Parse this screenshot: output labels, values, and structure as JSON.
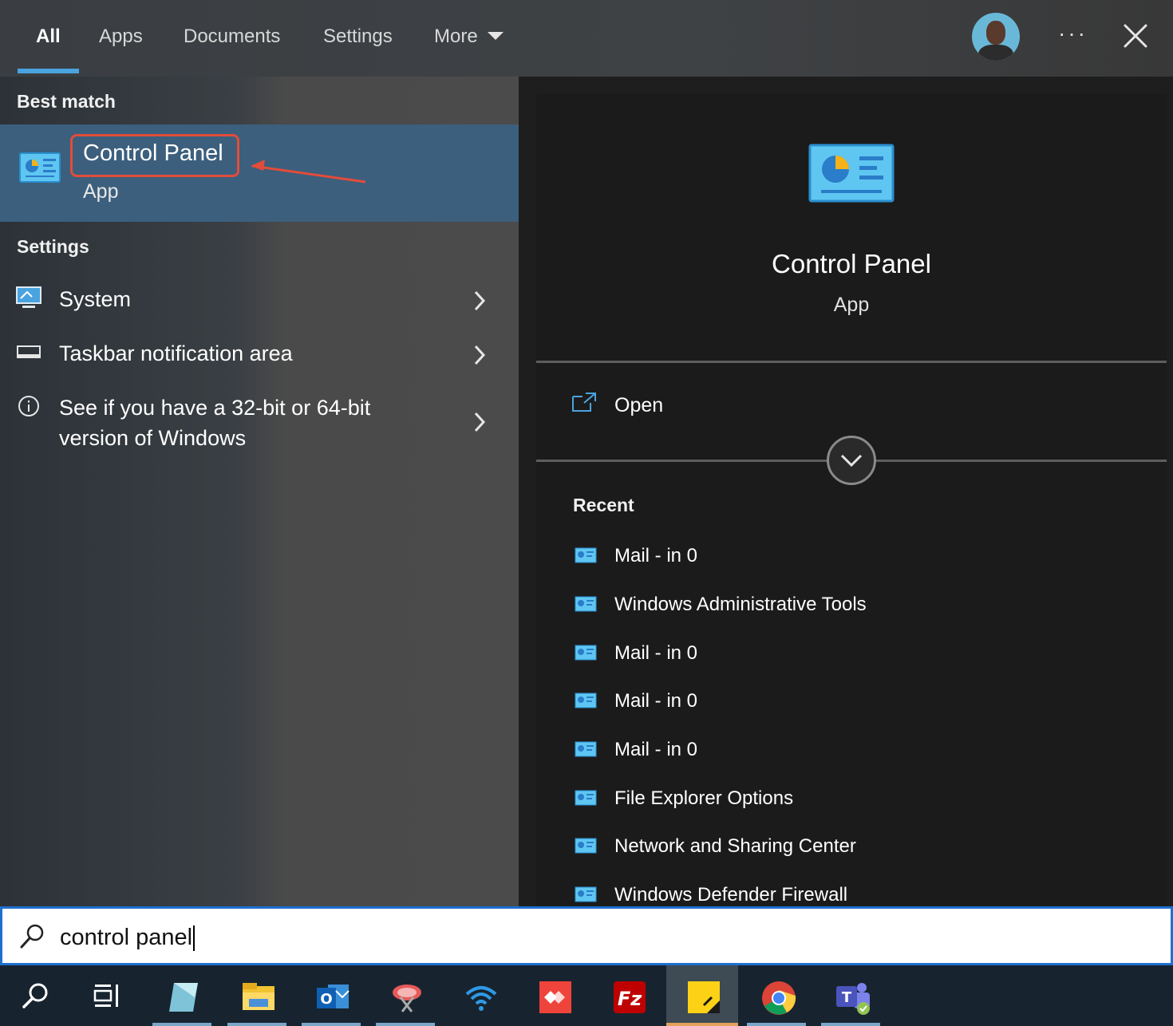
{
  "tabs": [
    {
      "label": "All",
      "active": true
    },
    {
      "label": "Apps"
    },
    {
      "label": "Documents"
    },
    {
      "label": "Settings"
    },
    {
      "label": "More"
    }
  ],
  "header": {
    "more_icon": "ellipsis-icon",
    "close_icon": "close-icon",
    "avatar_icon": "user-avatar"
  },
  "best_match": {
    "heading": "Best match",
    "title": "Control Panel",
    "subtitle": "App",
    "icon": "control-panel-icon",
    "highlight_color": "#e24c3a"
  },
  "settings": {
    "heading": "Settings",
    "items": [
      {
        "label": "System",
        "icon": "monitor-icon"
      },
      {
        "label": "Taskbar notification area",
        "icon": "taskbar-icon"
      },
      {
        "label": "See if you have a 32-bit or 64-bit",
        "label2": "version of Windows",
        "icon": "info-icon"
      }
    ]
  },
  "detail": {
    "title": "Control Panel",
    "subtitle": "App",
    "open_label": "Open",
    "recent_heading": "Recent",
    "recent": [
      "Mail - in 0",
      "Windows Administrative Tools",
      "Mail - in 0",
      "Mail - in 0",
      "Mail - in 0",
      "File Explorer Options",
      "Network and Sharing Center",
      "Windows Defender Firewall"
    ]
  },
  "search": {
    "value": "control panel",
    "icon": "search-icon"
  },
  "taskbar": [
    {
      "name": "search-icon"
    },
    {
      "name": "task-view-icon"
    },
    {
      "name": "app-icon"
    },
    {
      "name": "file-explorer-icon"
    },
    {
      "name": "outlook-icon"
    },
    {
      "name": "snipping-tool-icon"
    },
    {
      "name": "wifi-icon"
    },
    {
      "name": "anydesk-icon"
    },
    {
      "name": "filezilla-icon"
    },
    {
      "name": "sticky-notes-icon",
      "active": true
    },
    {
      "name": "chrome-icon"
    },
    {
      "name": "teams-icon"
    }
  ],
  "colors": {
    "accent": "#4aa3df",
    "selection": "#3c5f7d",
    "search_border": "#1e6fd0"
  }
}
